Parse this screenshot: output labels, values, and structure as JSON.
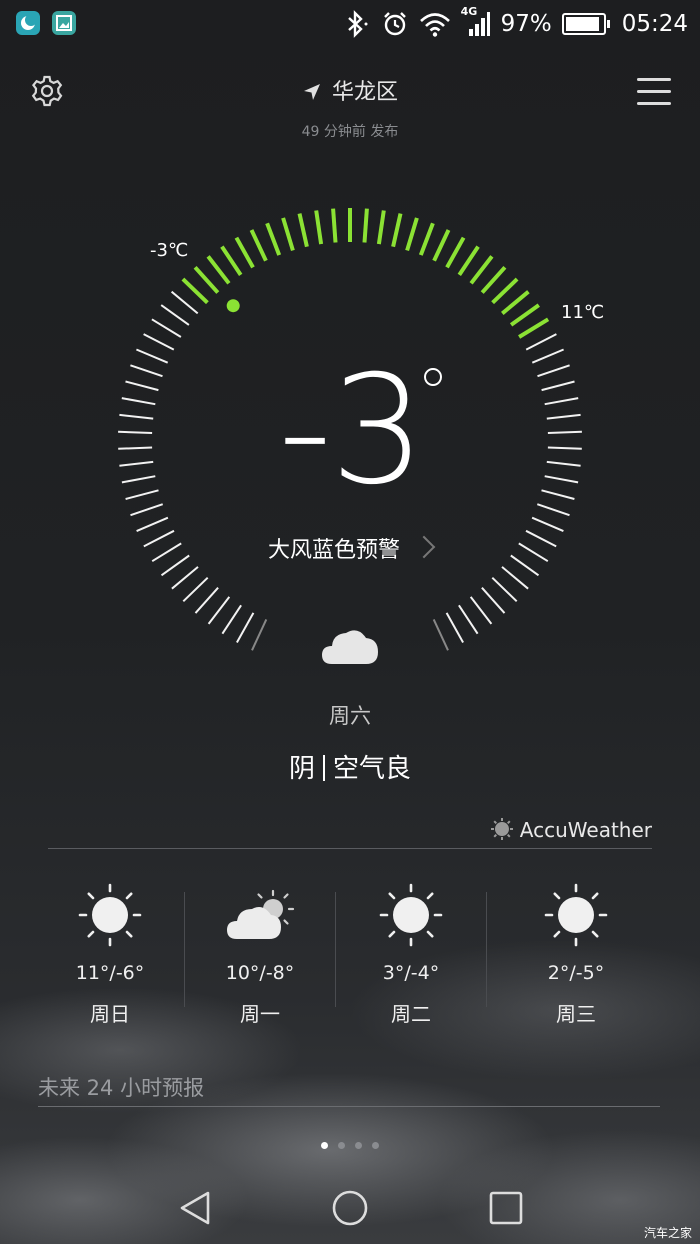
{
  "status_bar": {
    "network": "4G",
    "battery": "97%",
    "time": "05:24",
    "icons": [
      "moon-app-icon",
      "gallery-app-icon",
      "bluetooth-icon",
      "alarm-icon",
      "wifi-icon",
      "signal-icon",
      "battery-icon"
    ]
  },
  "header": {
    "location": "华龙区",
    "published": "49 分钟前 发布"
  },
  "current": {
    "min_label": "-3℃",
    "max_label": "11℃",
    "temperature": "-3",
    "warning": "大风蓝色预警",
    "day": "周六",
    "condition": "阴",
    "air_quality": "空气良",
    "gauge": {
      "min": -3,
      "max": 11,
      "current": -3,
      "highlight_color": "#8be234"
    }
  },
  "provider": "AccuWeather",
  "forecast": [
    {
      "icon": "sun-icon",
      "temp": "11°/-6°",
      "day": "周日"
    },
    {
      "icon": "cloudy-sun-icon",
      "temp": "10°/-8°",
      "day": "周一"
    },
    {
      "icon": "sun-icon",
      "temp": "3°/-4°",
      "day": "周二"
    },
    {
      "icon": "sun-icon",
      "temp": "2°/-5°",
      "day": "周三"
    }
  ],
  "hourly_title": "未来 24 小时预报",
  "pager": {
    "pages": 4,
    "current": 1
  },
  "watermark": "汽车之家"
}
